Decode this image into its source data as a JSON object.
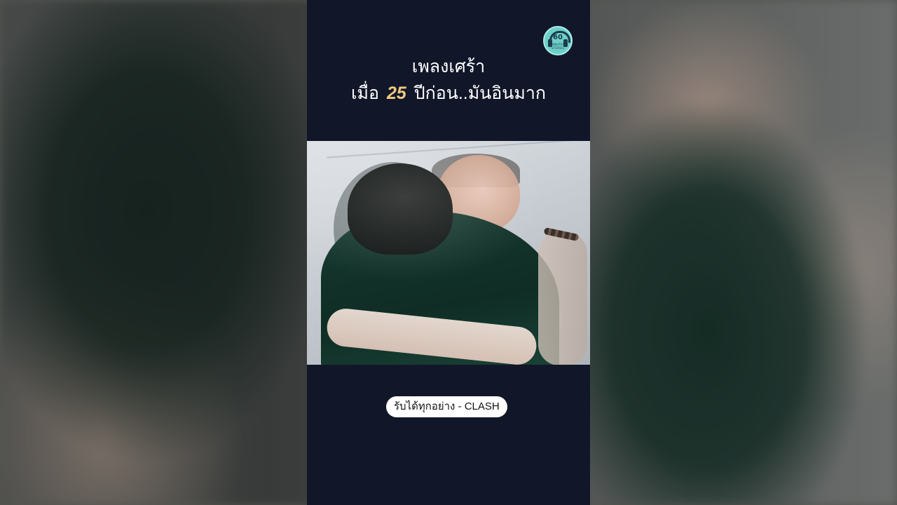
{
  "short": {
    "title_line1": "เพลงเศร้า",
    "title_line2_prefix": "เมื่อ",
    "title_line2_number": "25",
    "title_line2_suffix": "ปีก่อน..มันอินมาก",
    "song_caption": "รับได้ทุกอย่าง - CLASH",
    "channel_logo": {
      "icon": "headphones-icon",
      "number": "60",
      "tagline": "MINUTES STORIES"
    }
  },
  "colors": {
    "panel_background": "#111729",
    "title_text": "#ffffff",
    "number_highlight": "#f0c980",
    "caption_background": "#ffffff",
    "logo_teal": "#6ecfc9"
  }
}
